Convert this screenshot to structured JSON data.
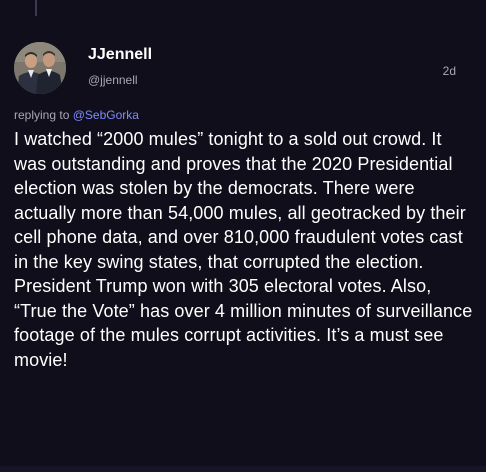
{
  "post": {
    "author": {
      "display_name": "JJennell",
      "handle": "@jjennell",
      "avatar_icon": "profile-photo-two-men"
    },
    "timestamp": "2d",
    "reply": {
      "prefix": "replying to",
      "mention": "@SebGorka"
    },
    "body": "I watched “2000 mules” tonight to a sold out crowd. It was outstanding and proves that the 2020 Presidential election was stolen by the democrats. There were actually more than 54,000 mules, all geotracked by their cell phone data, and over 810,000 fraudulent votes cast in the key swing states, that corrupted the election. President Trump won with 305 electoral votes. Also, “True the Vote” has over 4 million minutes of surveillance footage of the mules corrupt activities. It’s a must see movie!"
  },
  "colors": {
    "background": "#0f0e1a",
    "text": "#ffffff",
    "secondary_text": "#a9a7b8",
    "mention": "#7d8dff"
  }
}
